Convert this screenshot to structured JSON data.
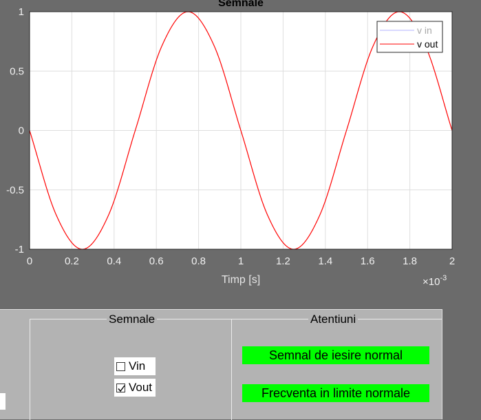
{
  "chart_data": {
    "type": "line",
    "title": "Semnale",
    "xlabel": "Timp [s]",
    "x_exponent": "×10",
    "x_exponent_power": "-3",
    "x_scale": 0.001,
    "xlim": [
      0,
      2
    ],
    "ylim": [
      -1,
      1
    ],
    "x_ticks": [
      "0",
      "0.2",
      "0.4",
      "0.6",
      "0.8",
      "1",
      "1.2",
      "1.4",
      "1.6",
      "1.8",
      "2"
    ],
    "y_ticks": [
      "1",
      "0.5",
      "0",
      "-0.5",
      "-1"
    ],
    "grid": true,
    "legend_position": "top-right",
    "series": [
      {
        "name": "v in",
        "color": "#8080ff",
        "visible": false,
        "x": [],
        "y": []
      },
      {
        "name": "v out",
        "color": "#ff0000",
        "visible": true,
        "x": [
          0,
          0.125,
          0.25,
          0.375,
          0.5,
          0.625,
          0.75,
          0.875,
          1.0,
          1.125,
          1.25,
          1.375,
          1.5,
          1.625,
          1.75,
          1.875,
          2.0
        ],
        "y": [
          0,
          -0.707,
          -1,
          -0.707,
          0,
          0.707,
          1,
          0.707,
          0,
          -0.707,
          -1,
          -0.707,
          0,
          0.707,
          1,
          0.707,
          0
        ]
      }
    ]
  },
  "panel": {
    "signals_group": {
      "title": "Semnale",
      "checkboxes": [
        {
          "label": "Vin",
          "checked": false
        },
        {
          "label": "Vout",
          "checked": true
        }
      ]
    },
    "alerts_group": {
      "title": "Atentiuni",
      "messages": [
        "Semnal de iesire normal",
        "Frecventa in limite normale"
      ],
      "color": "#00ff00"
    }
  }
}
